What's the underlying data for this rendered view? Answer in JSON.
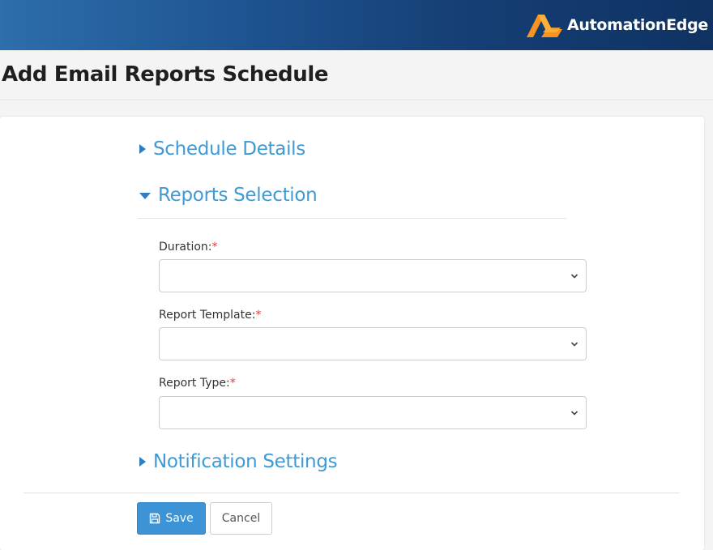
{
  "brand": {
    "name": "AutomationEdge",
    "logo_icon": "automationedge-logo-icon",
    "colors": {
      "orange": "#f7931e",
      "yellow": "#fbb03b"
    }
  },
  "page": {
    "title": "Add Email Reports Schedule"
  },
  "sections": {
    "schedule_details": {
      "label": "Schedule Details",
      "expanded": false
    },
    "reports_selection": {
      "label": "Reports Selection",
      "expanded": true
    },
    "notification_settings": {
      "label": "Notification Settings",
      "expanded": false
    }
  },
  "form": {
    "duration": {
      "label": "Duration:",
      "required_mark": "*",
      "value": ""
    },
    "report_template": {
      "label": "Report Template:",
      "required_mark": "*",
      "value": ""
    },
    "report_type": {
      "label": "Report Type:",
      "required_mark": "*",
      "value": ""
    }
  },
  "actions": {
    "save_label": "Save",
    "cancel_label": "Cancel"
  },
  "theme": {
    "accent": "#3c93d6",
    "link": "#3f9ad6",
    "required": "#e03a3a"
  }
}
